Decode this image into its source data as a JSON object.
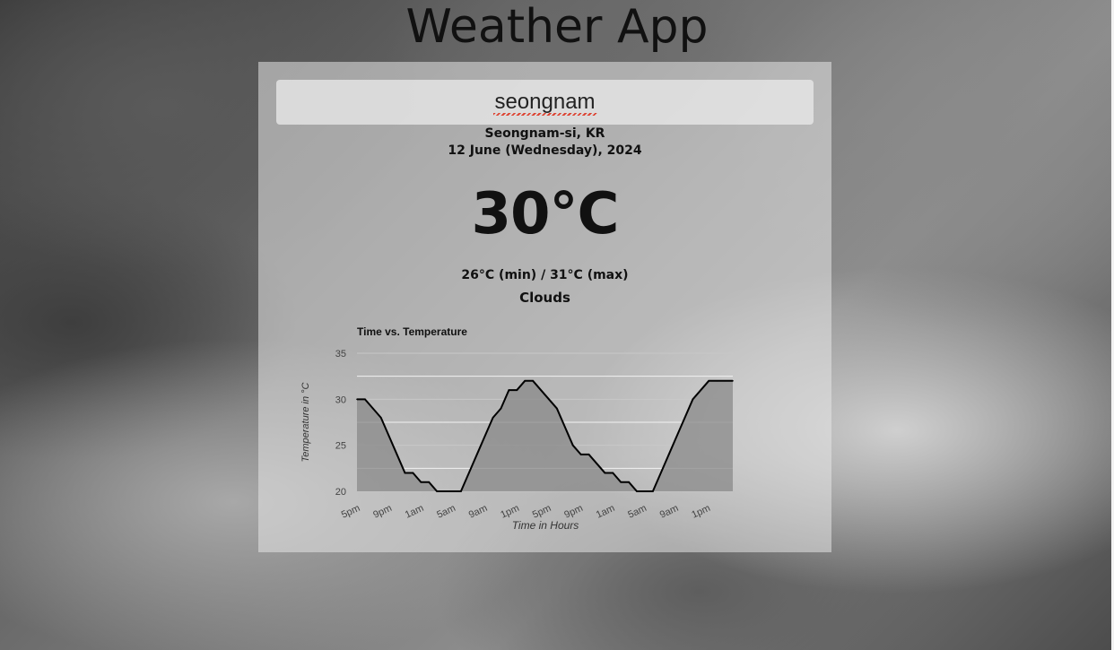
{
  "app": {
    "title": "Weather App"
  },
  "search": {
    "value": "seongnam"
  },
  "weather": {
    "location": "Seongnam-si, KR",
    "date": "12 June (Wednesday), 2024",
    "temperature": "30°C",
    "min_max": "26°C (min) / 31°C (max)",
    "description": "Clouds"
  },
  "chart_data": {
    "type": "area",
    "title": "Time vs. Temperature",
    "xlabel": "Time in Hours",
    "ylabel": "Temperature in °C",
    "ylim": [
      20,
      35
    ],
    "y_ticks": [
      20,
      25,
      30,
      35
    ],
    "x_tick_labels": [
      "5pm",
      "9pm",
      "1am",
      "5am",
      "9am",
      "1pm",
      "5pm",
      "9pm",
      "1am",
      "5am",
      "9am",
      "1pm"
    ],
    "values": [
      30,
      30,
      29,
      28,
      26,
      24,
      22,
      22,
      21,
      21,
      20,
      20,
      20,
      20,
      22,
      24,
      26,
      28,
      29,
      31,
      31,
      32,
      32,
      31,
      30,
      29,
      27,
      25,
      24,
      24,
      23,
      22,
      22,
      21,
      21,
      20,
      20,
      20,
      22,
      24,
      26,
      28,
      30,
      31,
      32,
      32,
      32,
      32
    ],
    "grid": true,
    "legend": "none",
    "colors": {
      "line": "#000000",
      "fill": "#8a8a8a"
    }
  }
}
